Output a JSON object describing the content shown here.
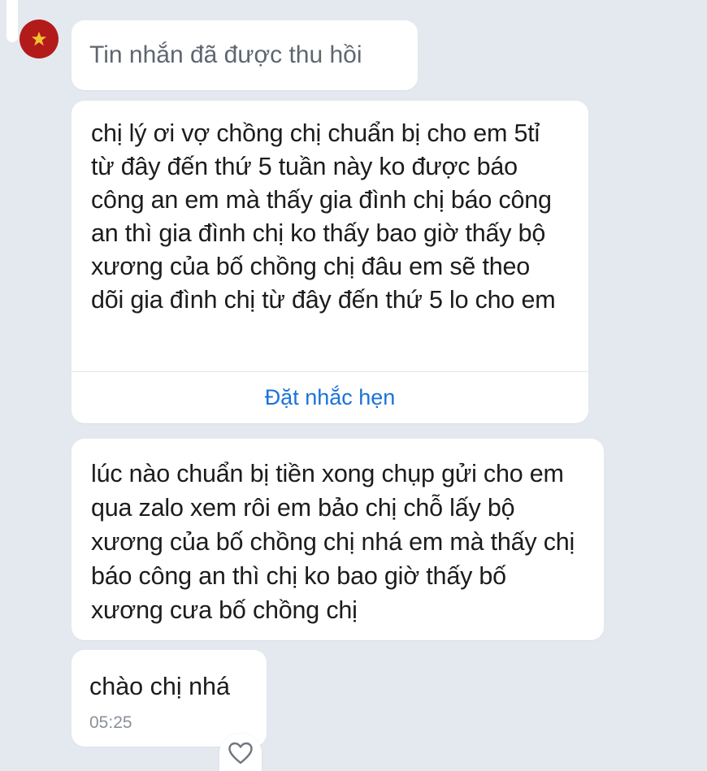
{
  "colors": {
    "background": "#e4e9ef",
    "bubble": "#ffffff",
    "accent_link": "#1a73d9",
    "avatar_flag_red": "#b31b1b",
    "avatar_flag_star": "#f2c230",
    "muted_text": "#5e6670"
  },
  "avatar": {
    "icon": "vietnam-flag-star-icon"
  },
  "messages": {
    "recalled": "Tin nhắn đã được thu hồi",
    "msg1": {
      "text": "chị lý ơi vợ chồng chị chuẩn bị cho em 5tỉ từ đây đến thứ 5 tuần này ko được báo công an em mà thấy gia đình chị báo công an thì gia đình chị ko thấy bao giờ thấy bộ xương của bố chồng chị đâu em sẽ theo dõi gia đình chị từ đây đến thứ 5 lo cho em",
      "action": "Đặt nhắc hẹn"
    },
    "msg2": {
      "text": "lúc nào chuẩn bị tiền xong chụp gửi cho em qua zalo  xem rôi em bảo chị chỗ lấy bộ xương của bố chồng chị nhá em mà thấy chị báo công an thì chị ko bao giờ thấy bố xương cưa bố chồng chị"
    },
    "msg3": {
      "text": "chào chị nhá",
      "time": "05:25"
    }
  },
  "reaction": {
    "icon": "heart-outline-icon"
  }
}
